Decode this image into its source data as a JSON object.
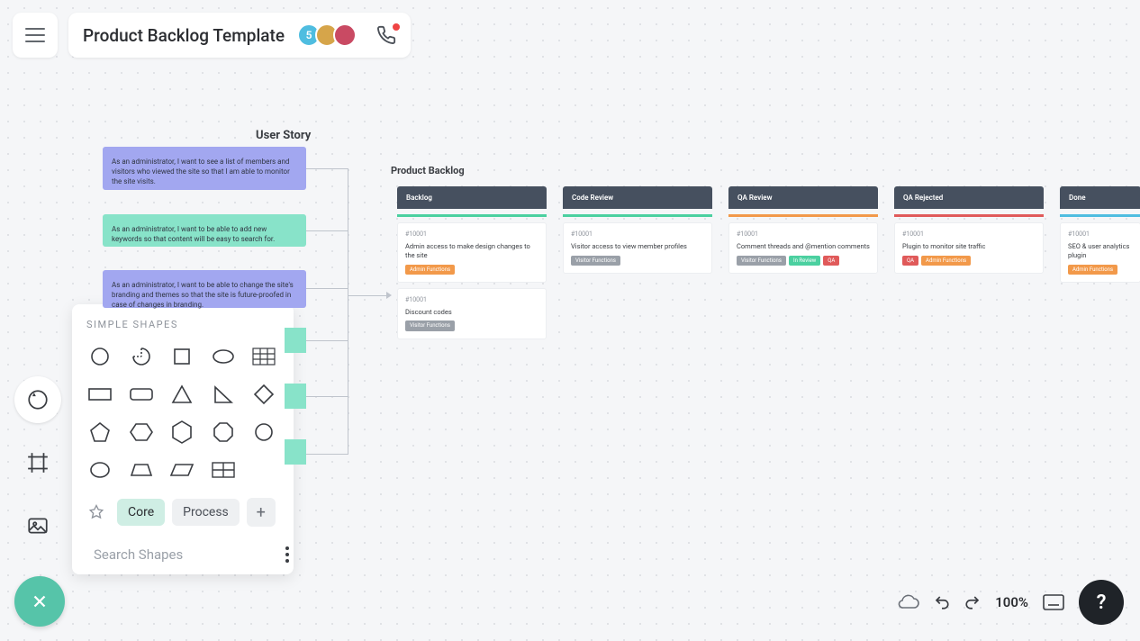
{
  "header": {
    "title": "Product Backlog Template",
    "avatars": [
      {
        "label": "5",
        "bg": "#4fbde0"
      },
      {
        "label": "",
        "bg": "#d6a54a"
      },
      {
        "label": "",
        "bg": "#c94a63"
      }
    ]
  },
  "user_story": {
    "heading": "User Story",
    "cards": [
      "As an administrator, I want to see a list of members and visitors who viewed the site so that I am able to monitor the site visits.",
      "As an administrator, I want to be able to add new keywords so that content will be easy to search for.",
      "As an administrator, I want to be able to change the site's branding and themes so that the site is future-proofed in case of changes in branding."
    ]
  },
  "board": {
    "title": "Product Backlog",
    "columns": [
      {
        "name": "Backlog",
        "accent": "#4bd0a0",
        "cards": [
          {
            "id": "#10001",
            "text": "Admin access to make design changes to the site",
            "tags": [
              {
                "label": "Admin Functions",
                "color": "#f2994a"
              }
            ]
          },
          {
            "id": "#10001",
            "text": "Discount codes",
            "tags": [
              {
                "label": "Visitor Functions",
                "color": "#9aa0a8"
              }
            ]
          }
        ]
      },
      {
        "name": "Code Review",
        "accent": "#4bd0a0",
        "cards": [
          {
            "id": "#10001",
            "text": "Visitor access to view member profiles",
            "tags": [
              {
                "label": "Visitor Functions",
                "color": "#9aa0a8"
              }
            ]
          }
        ]
      },
      {
        "name": "QA Review",
        "accent": "#f2994a",
        "cards": [
          {
            "id": "#10001",
            "text": "Comment threads and @mention comments",
            "tags": [
              {
                "label": "Visitor Functions",
                "color": "#9aa0a8"
              },
              {
                "label": "In Review",
                "color": "#4bd0a0"
              },
              {
                "label": "QA",
                "color": "#e05a5a"
              }
            ]
          }
        ]
      },
      {
        "name": "QA Rejected",
        "accent": "#e05a5a",
        "cards": [
          {
            "id": "#10001",
            "text": "Plugin to monitor site traffic",
            "tags": [
              {
                "label": "QA",
                "color": "#e05a5a"
              },
              {
                "label": "Admin Functions",
                "color": "#f2994a"
              }
            ]
          }
        ]
      },
      {
        "name": "Done",
        "accent": "#4fbde0",
        "cards": [
          {
            "id": "#10001",
            "text": "SEO & user analytics plugin",
            "tags": [
              {
                "label": "Admin Functions",
                "color": "#f2994a"
              }
            ]
          }
        ]
      }
    ]
  },
  "shapes_panel": {
    "heading": "SIMPLE SHAPES",
    "tabs": {
      "core": "Core",
      "process": "Process"
    },
    "search_placeholder": "Search Shapes"
  },
  "footer": {
    "zoom": "100%"
  }
}
